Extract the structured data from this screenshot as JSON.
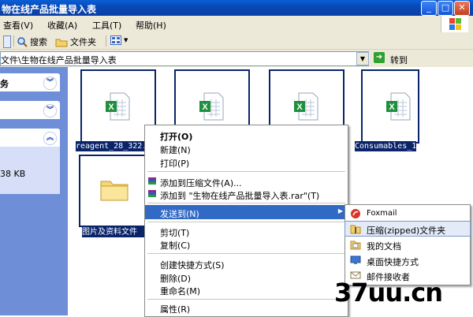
{
  "window": {
    "title": "物在线产品批量导入表"
  },
  "menubar": {
    "items": [
      "查看(V)",
      "收藏(A)",
      "工具(T)",
      "帮助(H)"
    ]
  },
  "toolbar": {
    "search_label": "搜索",
    "folders_label": "文件夹"
  },
  "address": {
    "path": "文件\\生物在线产品批量导入表",
    "go_label": "转到"
  },
  "left_pane": {
    "section1": "务",
    "detail_size": "38 KB"
  },
  "files": [
    {
      "caption": "reagent_28_322."
    },
    {
      "caption": ""
    },
    {
      "caption": ""
    },
    {
      "caption": "Consumables_1"
    },
    {
      "caption": "图片及资料文件"
    }
  ],
  "context_menu": {
    "items": [
      "打开(O)",
      "新建(N)",
      "打印(P)",
      "添加到压缩文件(A)...",
      "添加到 \"生物在线产品批量导入表.rar\"(T)",
      "发送到(N)",
      "剪切(T)",
      "复制(C)",
      "创建快捷方式(S)",
      "删除(D)",
      "重命名(M)",
      "属性(R)"
    ]
  },
  "sendto_menu": {
    "items": [
      "Foxmail",
      "压缩(zipped)文件夹",
      "我的文档",
      "桌面快捷方式",
      "邮件接收者"
    ]
  },
  "watermark": "37uu.cn",
  "colors": {
    "selection": "#316ac5",
    "titlebar": "#0849b5",
    "pane": "#6f8ed8"
  }
}
